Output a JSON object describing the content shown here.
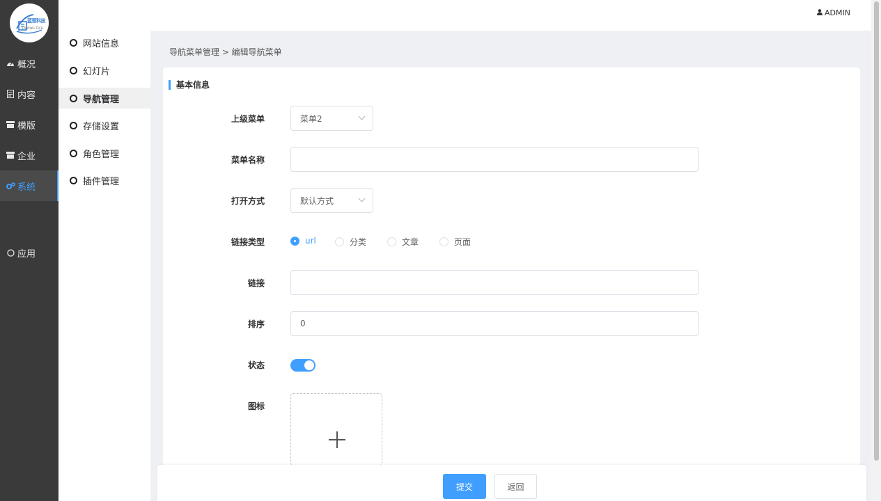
{
  "logo": {
    "text": "蓝莹科技",
    "subtext": "LANYING TECH"
  },
  "nav": {
    "items": [
      {
        "icon": "dashboard-icon",
        "label": "概况",
        "active": false
      },
      {
        "icon": "document-icon",
        "label": "内容",
        "active": false
      },
      {
        "icon": "template-icon",
        "label": "模版",
        "active": false
      },
      {
        "icon": "company-icon",
        "label": "企业",
        "active": false
      },
      {
        "icon": "gears-icon",
        "label": "系统",
        "active": true
      },
      {
        "icon": "circle-icon",
        "label": "应用",
        "active": false
      }
    ]
  },
  "header": {
    "user": "ADMIN",
    "user_icon": "user-icon"
  },
  "submenu": {
    "items": [
      {
        "label": "网站信息",
        "active": false
      },
      {
        "label": "幻灯片",
        "active": false
      },
      {
        "label": "导航管理",
        "active": true
      },
      {
        "label": "存储设置",
        "active": false
      },
      {
        "label": "角色管理",
        "active": false
      },
      {
        "label": "插件管理",
        "active": false
      }
    ]
  },
  "breadcrumb": "导航菜单管理 > 编辑导航菜单",
  "section_title": "基本信息",
  "form": {
    "parent_menu": {
      "label": "上级菜单",
      "value": "菜单2"
    },
    "menu_name": {
      "label": "菜单名称",
      "value": "",
      "placeholder": ""
    },
    "open_mode": {
      "label": "打开方式",
      "value": "默认方式"
    },
    "link_type": {
      "label": "链接类型",
      "options": [
        "url",
        "分类",
        "文章",
        "页面"
      ],
      "selected": "url"
    },
    "link": {
      "label": "链接",
      "value": ""
    },
    "sort": {
      "label": "排序",
      "value": "0"
    },
    "status": {
      "label": "状态",
      "enabled": true
    },
    "icon": {
      "label": "图标"
    }
  },
  "actions": {
    "submit": "提交",
    "back": "返回"
  },
  "colors": {
    "accent": "#409eff",
    "sidebar": "#3a3a3a",
    "background": "#eef0f4"
  }
}
